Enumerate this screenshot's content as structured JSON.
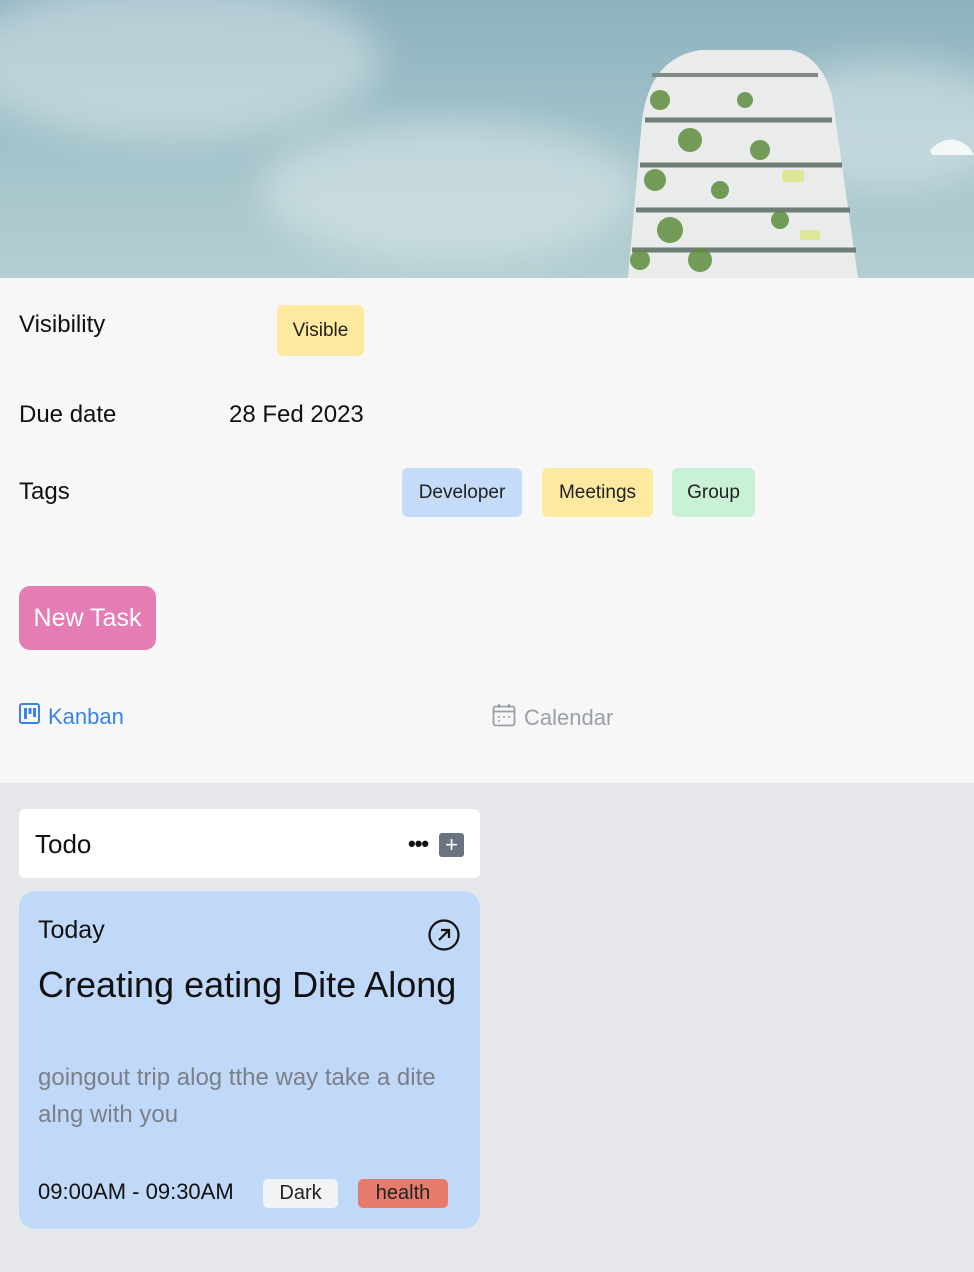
{
  "details": {
    "visibility_label": "Visibility",
    "visibility_value": "Visible",
    "due_label": "Due date",
    "due_value": "28 Fed 2023",
    "tags_label": "Tags",
    "tags": [
      "Developer",
      "Meetings",
      "Group"
    ]
  },
  "actions": {
    "new_task_label": "New Task"
  },
  "views": {
    "kanban_label": "Kanban",
    "calendar_label": "Calendar"
  },
  "board": {
    "column": {
      "title": "Todo",
      "menu_glyph": "•••",
      "add_glyph": "+"
    },
    "card": {
      "day": "Today",
      "title": "Creating eating Dite Along",
      "description": "goingout trip alog tthe way take a dite alng with you",
      "time": "09:00AM - 09:30AM",
      "tags": [
        "Dark",
        "health"
      ]
    }
  },
  "colors": {
    "new_task": "#e57cb4",
    "kanban_active": "#3a83e4",
    "card_bg": "#c1d9f8",
    "tag_developer": "#c5dbfa",
    "tag_meetings": "#fdeaa0",
    "tag_group": "#c8f1d6",
    "tag_health": "#e67b6d"
  }
}
